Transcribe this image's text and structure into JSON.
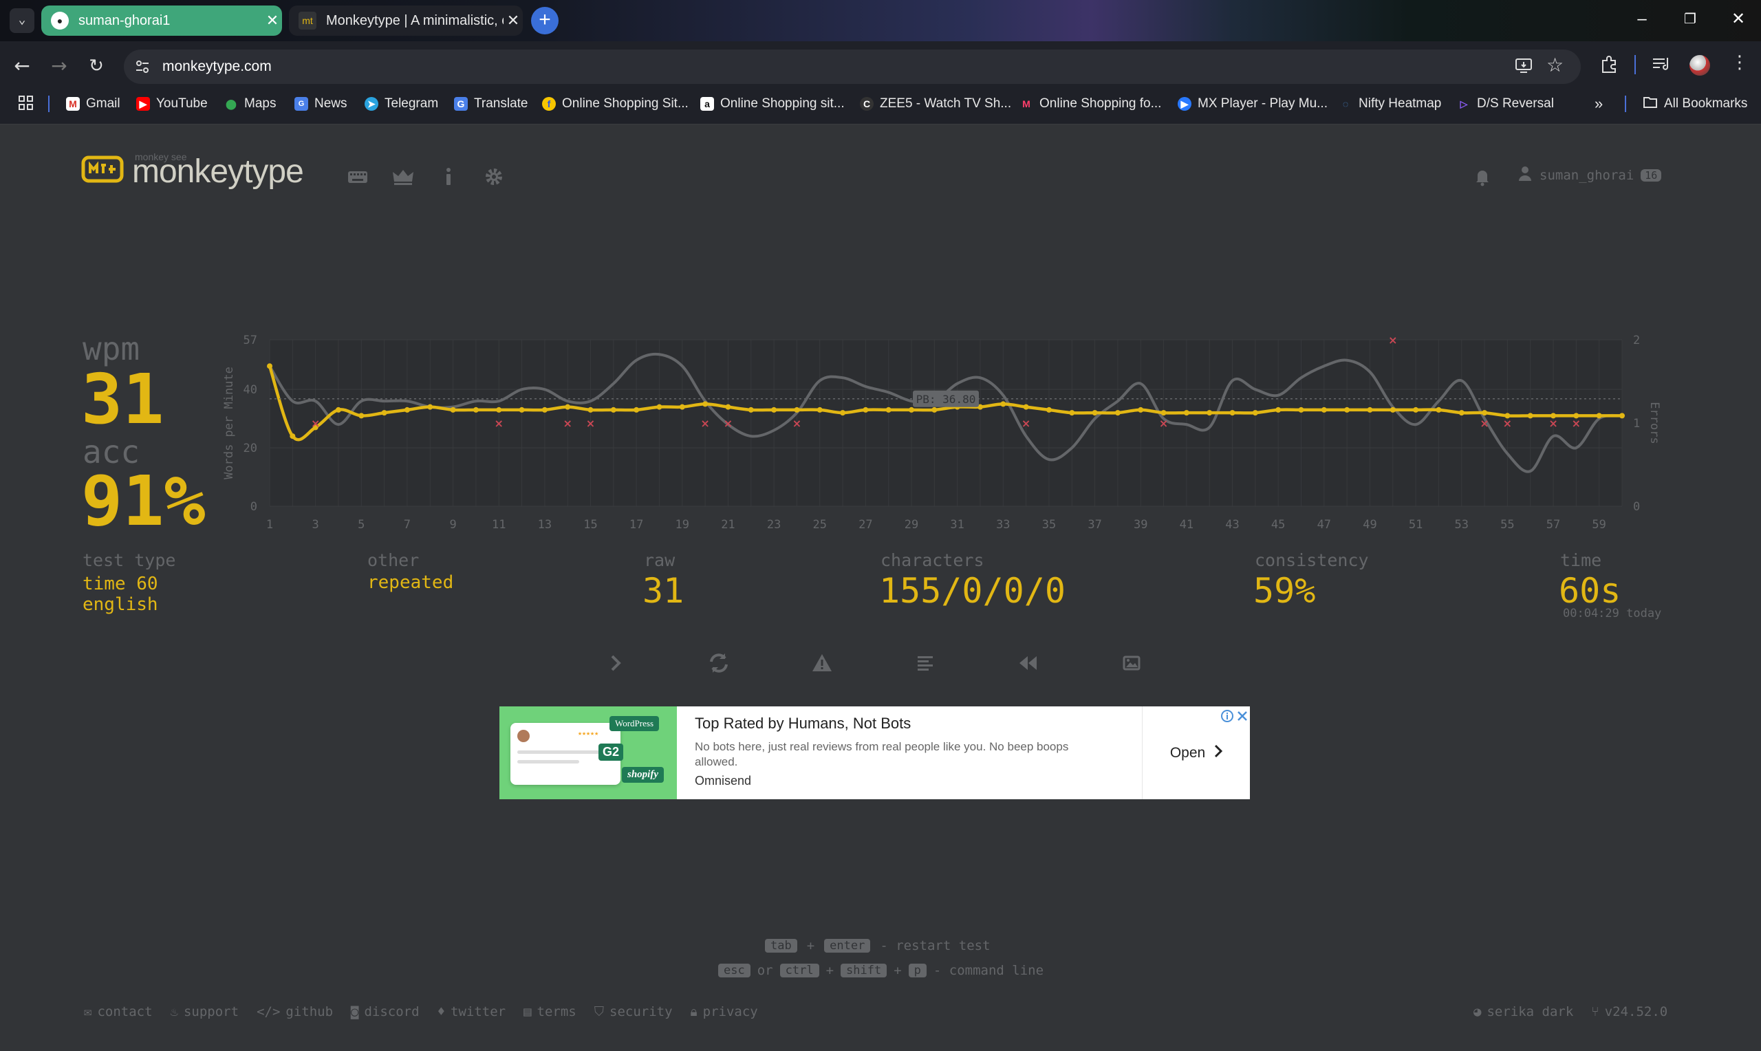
{
  "browser": {
    "tabs": [
      {
        "title": "suman-ghorai1",
        "favicon": "github-icon",
        "active": false
      },
      {
        "title": "Monkeytype | A minimalistic, cu",
        "favicon": "mt",
        "active": true
      }
    ],
    "url": "monkeytype.com",
    "bookmarks": [
      {
        "label": "Gmail",
        "icon": "gmail-icon"
      },
      {
        "label": "YouTube",
        "icon": "youtube-icon"
      },
      {
        "label": "Maps",
        "icon": "maps-icon"
      },
      {
        "label": "News",
        "icon": "news-icon"
      },
      {
        "label": "Telegram",
        "icon": "telegram-icon"
      },
      {
        "label": "Translate",
        "icon": "translate-icon"
      },
      {
        "label": "Online Shopping Sit...",
        "icon": "flipkart-icon"
      },
      {
        "label": "Online Shopping sit...",
        "icon": "amazon-icon"
      },
      {
        "label": "ZEE5 - Watch TV Sh...",
        "icon": "zee5-icon"
      },
      {
        "label": "Online Shopping fo...",
        "icon": "myntra-icon"
      },
      {
        "label": "MX Player - Play Mu...",
        "icon": "mxplayer-icon"
      },
      {
        "label": "Nifty Heatmap",
        "icon": "heatmap-icon"
      },
      {
        "label": "D/S Reversal",
        "icon": "reversal-icon"
      }
    ],
    "all_bookmarks": "All Bookmarks"
  },
  "header": {
    "logo_text": "monkeytype",
    "logo_subtext": "monkey see",
    "username": "suman_ghorai",
    "level": "16"
  },
  "result": {
    "wpm_label": "wpm",
    "wpm": "31",
    "acc_label": "acc",
    "acc": "91%",
    "test_type_label": "test type",
    "test_type_line1": "time 60",
    "test_type_line2": "english",
    "other_label": "other",
    "other_value": "repeated",
    "raw_label": "raw",
    "raw_value": "31",
    "characters_label": "characters",
    "characters_value": "155/0/0/0",
    "consistency_label": "consistency",
    "consistency_value": "59%",
    "time_label": "time",
    "time_value": "60s",
    "time_detail": "00:04:29 today"
  },
  "chart_data": {
    "type": "line",
    "ylabel": "Words per Minute",
    "y2label": "Errors",
    "ylim": [
      0,
      57
    ],
    "yticks": [
      "57",
      "40",
      "20",
      "0"
    ],
    "y2lim": [
      0,
      2
    ],
    "y2ticks": [
      "2",
      "1",
      "0"
    ],
    "xticks": [
      "1",
      "3",
      "5",
      "7",
      "9",
      "11",
      "13",
      "15",
      "17",
      "19",
      "21",
      "23",
      "25",
      "27",
      "29",
      "31",
      "33",
      "35",
      "37",
      "39",
      "41",
      "43",
      "45",
      "47",
      "49",
      "51",
      "53",
      "55",
      "57",
      "59"
    ],
    "pb_label": "PB: 36.80",
    "pb_value": 36.8,
    "series": [
      {
        "role": "wpm",
        "color": "#e2b714",
        "x": [
          1,
          2,
          3,
          4,
          5,
          6,
          7,
          8,
          9,
          10,
          11,
          12,
          13,
          14,
          15,
          16,
          17,
          18,
          19,
          20,
          21,
          22,
          23,
          24,
          25,
          26,
          27,
          28,
          29,
          30,
          31,
          32,
          33,
          34,
          35,
          36,
          37,
          38,
          39,
          40,
          41,
          42,
          43,
          44,
          45,
          46,
          47,
          48,
          49,
          50,
          51,
          52,
          53,
          54,
          55,
          56,
          57,
          58,
          59,
          60
        ],
        "values": [
          48,
          24,
          27,
          33,
          31,
          32,
          33,
          34,
          33,
          33,
          33,
          33,
          33,
          34,
          33,
          33,
          33,
          34,
          34,
          35,
          34,
          33,
          33,
          33,
          33,
          32,
          33,
          33,
          33,
          33,
          34,
          34,
          35,
          34,
          33,
          32,
          32,
          32,
          33,
          32,
          32,
          32,
          32,
          32,
          33,
          33,
          33,
          33,
          33,
          33,
          33,
          33,
          32,
          32,
          31,
          31,
          31,
          31,
          31,
          31
        ]
      },
      {
        "role": "raw",
        "color": "#646669",
        "x": [
          1,
          2,
          3,
          4,
          5,
          6,
          7,
          8,
          9,
          10,
          11,
          12,
          13,
          14,
          15,
          16,
          17,
          18,
          19,
          20,
          21,
          22,
          23,
          24,
          25,
          26,
          27,
          28,
          29,
          30,
          31,
          32,
          33,
          34,
          35,
          36,
          37,
          38,
          39,
          40,
          41,
          42,
          43,
          44,
          45,
          46,
          47,
          48,
          49,
          50,
          51,
          52,
          53,
          54,
          55,
          56,
          57,
          58,
          59,
          60
        ],
        "values": [
          48,
          36,
          36,
          28,
          36,
          36,
          36,
          34,
          34,
          36,
          36,
          40,
          40,
          36,
          36,
          42,
          50,
          52,
          48,
          36,
          28,
          24,
          26,
          32,
          43,
          44,
          41,
          39,
          36,
          36,
          42,
          44,
          38,
          24,
          16,
          20,
          30,
          36,
          42,
          30,
          28,
          27,
          43,
          40,
          38,
          44,
          48,
          50,
          46,
          34,
          28,
          36,
          43,
          30,
          18,
          12,
          24,
          20,
          30,
          31
        ]
      },
      {
        "role": "errors",
        "color": "#ca4754",
        "points": [
          [
            3,
            1
          ],
          [
            11,
            1
          ],
          [
            14,
            1
          ],
          [
            15,
            1
          ],
          [
            20,
            1
          ],
          [
            21,
            1
          ],
          [
            24,
            1
          ],
          [
            34,
            1
          ],
          [
            40,
            1
          ],
          [
            50,
            2
          ],
          [
            54,
            1
          ],
          [
            55,
            1
          ],
          [
            57,
            1
          ],
          [
            58,
            1
          ]
        ]
      }
    ]
  },
  "controls": [
    {
      "name": "next-test",
      "icon": "chevron-right-icon"
    },
    {
      "name": "repeat-test",
      "icon": "refresh-icon"
    },
    {
      "name": "practice-words",
      "icon": "warning-icon"
    },
    {
      "name": "toggle-words-history",
      "icon": "align-left-icon"
    },
    {
      "name": "watch-replay",
      "icon": "rewind-icon"
    },
    {
      "name": "save-screenshot",
      "icon": "image-icon"
    }
  ],
  "ad": {
    "title": "Top Rated by Humans, Not Bots",
    "description": "No bots here, just real reviews from real people like you. No beep boops allowed.",
    "brand": "Omnisend",
    "cta": "Open",
    "badge_wordpress": "WordPress",
    "badge_g2": "G2",
    "badge_shopify": "shopify"
  },
  "hints": {
    "key_tab": "tab",
    "plus": "+",
    "key_enter": "enter",
    "restart_text": "- restart test",
    "key_esc": "esc",
    "or": "or",
    "key_ctrl": "ctrl",
    "key_shift": "shift",
    "key_p": "p",
    "command_text": "- command line"
  },
  "footer": {
    "links": [
      "contact",
      "support",
      "github",
      "discord",
      "twitter",
      "terms",
      "security",
      "privacy"
    ],
    "theme": "serika dark",
    "version": "v24.52.0"
  }
}
